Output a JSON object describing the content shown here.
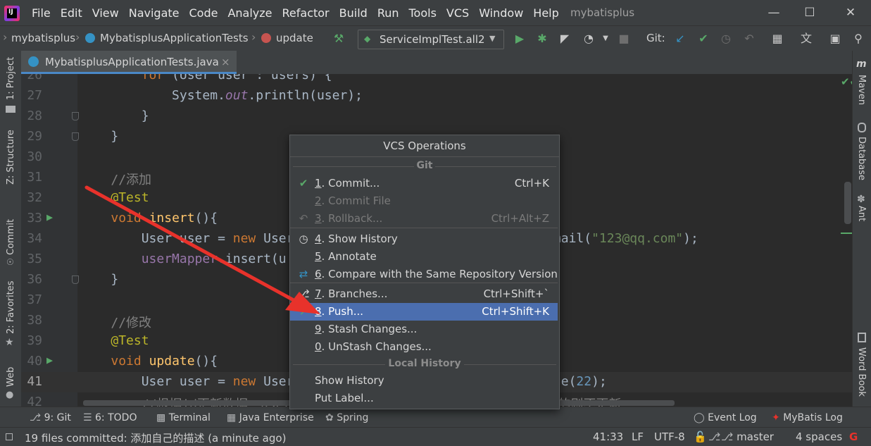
{
  "menubar": {
    "items": [
      "File",
      "Edit",
      "View",
      "Navigate",
      "Code",
      "Analyze",
      "Refactor",
      "Build",
      "Run",
      "Tools",
      "VCS",
      "Window",
      "Help"
    ],
    "project_title": "mybatisplus"
  },
  "navbar": {
    "crumbs": [
      "mybatisplus",
      "MybatisplusApplicationTests",
      "update"
    ],
    "run_config": "ServiceImplTest.all2",
    "git_label": "Git:"
  },
  "tabs": [
    {
      "label": "MybatisplusApplicationTests.java",
      "close": "×"
    }
  ],
  "left_tools": [
    {
      "label": "1: Project"
    },
    {
      "label": "Z: Structure"
    },
    {
      "label": "Commit"
    },
    {
      "label": "2: Favorites"
    },
    {
      "label": "Web"
    }
  ],
  "right_tools": [
    {
      "label": "Maven"
    },
    {
      "label": "Database"
    },
    {
      "label": "Ant"
    },
    {
      "label": "Word Book"
    }
  ],
  "editor": {
    "lines": [
      {
        "n": "26",
        "html": "        <span class='kw'>for</span> (User user : users) {"
      },
      {
        "n": "27",
        "html": "            System.<span class='fld'>out</span>.println(user);"
      },
      {
        "n": "28",
        "html": "        }"
      },
      {
        "n": "29",
        "html": "    }"
      },
      {
        "n": "30",
        "html": ""
      },
      {
        "n": "31",
        "html": "    <span class='cmt'>//添加</span>"
      },
      {
        "n": "32",
        "html": "    <span class='ann'>@Test</span>"
      },
      {
        "n": "33",
        "html": "    <span class='kw'>void</span> <span class='fn'>insert</span>(){"
      },
      {
        "n": "34",
        "html": "        User user = <span class='kw'>new</span> User                               etEmail(<span class='str'>\"123@qq.com\"</span>);"
      },
      {
        "n": "35",
        "html": "        <span class='var'>userMapper</span>.insert(u"
      },
      {
        "n": "36",
        "html": "    }"
      },
      {
        "n": "37",
        "html": ""
      },
      {
        "n": "38",
        "html": "    <span class='cmt'>//修改</span>"
      },
      {
        "n": "39",
        "html": "    <span class='ann'>@Test</span>"
      },
      {
        "n": "40",
        "html": "    <span class='kw'>void</span> <span class='fn'>update</span>(){"
      },
      {
        "n": "41",
        "html": "        User user = <span class='kw'>new</span> User                               etAge(<span class='num'>22</span>);"
      },
      {
        "n": "42",
        "html": "        <span class='cmt'>//根据id更新数据：user                              有赋值的则不更新</span>"
      }
    ]
  },
  "popup": {
    "title": "VCS Operations",
    "section_git": "Git",
    "section_local": "Local History",
    "items": [
      {
        "key": "1",
        "label": "Commit...",
        "shortcut": "Ctrl+K",
        "icon": "check-icon",
        "disabled": false
      },
      {
        "key": "2",
        "label": "Commit File",
        "shortcut": "",
        "icon": "",
        "disabled": true
      },
      {
        "key": "3",
        "label": "Rollback...",
        "shortcut": "Ctrl+Alt+Z",
        "icon": "undo-icon",
        "disabled": true
      },
      {
        "key": "4",
        "label": "Show History",
        "shortcut": "",
        "icon": "clock-icon",
        "disabled": false
      },
      {
        "key": "5",
        "label": "Annotate",
        "shortcut": "",
        "icon": "",
        "disabled": false
      },
      {
        "key": "6",
        "label": "Compare with the Same Repository Version",
        "shortcut": "",
        "icon": "compare-icon",
        "disabled": false
      },
      {
        "key": "7",
        "label": "Branches...",
        "shortcut": "Ctrl+Shift+`",
        "icon": "branch-icon",
        "disabled": false
      },
      {
        "key": "8",
        "label": "Push...",
        "shortcut": "Ctrl+Shift+K",
        "icon": "push-icon",
        "disabled": false,
        "selected": true
      },
      {
        "key": "9",
        "label": "Stash Changes...",
        "shortcut": "",
        "icon": "",
        "disabled": false
      },
      {
        "key": "0",
        "label": "UnStash Changes...",
        "shortcut": "",
        "icon": "",
        "disabled": false
      }
    ],
    "local_items": [
      "Show History",
      "Put Label..."
    ]
  },
  "bottom_tools": {
    "git": "9: Git",
    "todo": "6: TODO",
    "terminal": "Terminal",
    "java_ee": "Java Enterprise",
    "spring": "Spring",
    "event_log": "Event Log",
    "mybatis_log": "MyBatis Log"
  },
  "status": {
    "message": "19 files committed: 添加自己的描述 (a minute ago)",
    "position": "41:33",
    "line_sep": "LF",
    "encoding": "UTF-8",
    "branch": "master",
    "indent": "4 spaces"
  },
  "colors": {
    "accent": "#4b6eaf",
    "bg": "#2b2b2b",
    "panel": "#3c3f41",
    "arrow": "#e8322b"
  }
}
